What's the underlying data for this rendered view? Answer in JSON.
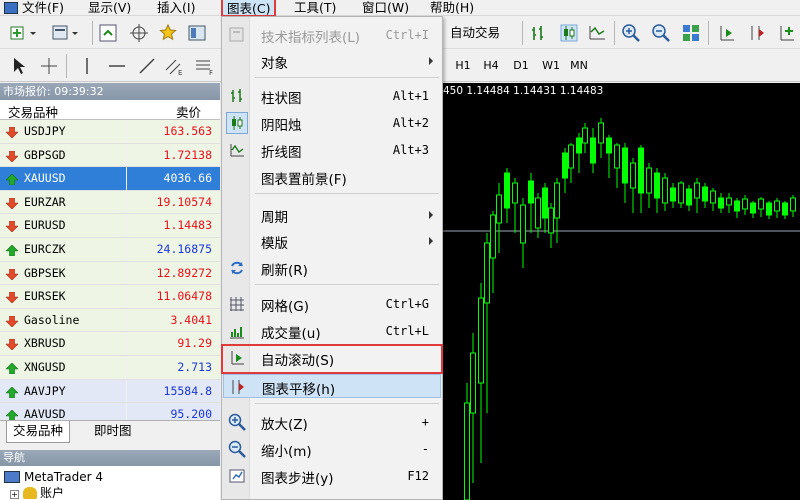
{
  "menubar": {
    "items": [
      "文件(F)",
      "显示(V)",
      "插入(I)",
      "图表(C)",
      "工具(T)",
      "窗口(W)",
      "帮助(H)"
    ]
  },
  "toolbar": {
    "auto_trading_label": "自动交易"
  },
  "timeframes": [
    "H1",
    "H4",
    "D1",
    "W1",
    "MN"
  ],
  "market_watch": {
    "title": "市场报价: 09:39:32",
    "col_symbol": "交易品种",
    "col_price": "卖价",
    "rows": [
      {
        "symbol": "USDJPY",
        "price": "163.563",
        "dir": "down",
        "price_color": "#e8111a"
      },
      {
        "symbol": "GBPSGD",
        "price": "1.72138",
        "dir": "down",
        "price_color": "#e8111a"
      },
      {
        "symbol": "XAUUSD",
        "price": "4036.66",
        "dir": "up",
        "price_color": "#ffffff"
      },
      {
        "symbol": "EURZAR",
        "price": "19.10574",
        "dir": "down",
        "price_color": "#e8111a"
      },
      {
        "symbol": "EURUSD",
        "price": "1.14483",
        "dir": "down",
        "price_color": "#e8111a"
      },
      {
        "symbol": "EURCZK",
        "price": "24.16875",
        "dir": "up",
        "price_color": "#1a37d8"
      },
      {
        "symbol": "GBPSEK",
        "price": "12.89272",
        "dir": "down",
        "price_color": "#e8111a"
      },
      {
        "symbol": "EURSEK",
        "price": "11.06478",
        "dir": "down",
        "price_color": "#e8111a"
      },
      {
        "symbol": "Gasoline",
        "price": "3.4041",
        "dir": "down",
        "price_color": "#e8111a"
      },
      {
        "symbol": "XBRUSD",
        "price": "91.29",
        "dir": "down",
        "price_color": "#e8111a"
      },
      {
        "symbol": "XNGUSD",
        "price": "2.713",
        "dir": "up",
        "price_color": "#1a37d8"
      },
      {
        "symbol": "AAVJPY",
        "price": "15584.8",
        "dir": "up",
        "price_color": "#1a37d8"
      },
      {
        "symbol": "AAVUSD",
        "price": "95.200",
        "dir": "up",
        "price_color": "#1a37d8"
      }
    ],
    "tabs": [
      "交易品种",
      "即时图"
    ]
  },
  "navigator": {
    "title": "导航",
    "root": "MetaTrader 4",
    "child": "账户"
  },
  "chart_menu": {
    "items": [
      {
        "label": "技术指标列表(L)",
        "shortcut": "Ctrl+I",
        "disabled": true,
        "icon": "indicator-list-icon"
      },
      {
        "label": "对象",
        "submenu": true
      },
      {
        "label": "柱状图",
        "shortcut": "Alt+1",
        "icon": "bar-chart-icon"
      },
      {
        "label": "阴阳烛",
        "shortcut": "Alt+2",
        "icon": "candlestick-icon",
        "checked": true
      },
      {
        "label": "折线图",
        "shortcut": "Alt+3",
        "icon": "line-chart-icon"
      },
      {
        "label": "图表置前景(F)"
      },
      {
        "label": "周期",
        "submenu": true
      },
      {
        "label": "模版",
        "submenu": true
      },
      {
        "label": "刷新(R)",
        "icon": "refresh-icon"
      },
      {
        "label": "网格(G)",
        "shortcut": "Ctrl+G",
        "icon": "grid-icon"
      },
      {
        "label": "成交量(u)",
        "shortcut": "Ctrl+L",
        "icon": "volume-icon"
      },
      {
        "label": "自动滚动(S)",
        "icon": "auto-scroll-icon",
        "highlighted": true
      },
      {
        "label": "图表平移(h)",
        "icon": "chart-shift-icon",
        "hover": true
      },
      {
        "label": "放大(Z)",
        "shortcut": "+",
        "icon": "zoom-in-icon"
      },
      {
        "label": "缩小(m)",
        "shortcut": "-",
        "icon": "zoom-out-icon"
      },
      {
        "label": "图表步进(y)",
        "shortcut": "F12",
        "icon": "step-icon"
      }
    ]
  },
  "chart": {
    "ohlc_text": "450 1.14484 1.14431 1.14483",
    "bg_color": "#000000",
    "candle_color": "#00ff00",
    "price_line_color": "#a0a8b8"
  }
}
